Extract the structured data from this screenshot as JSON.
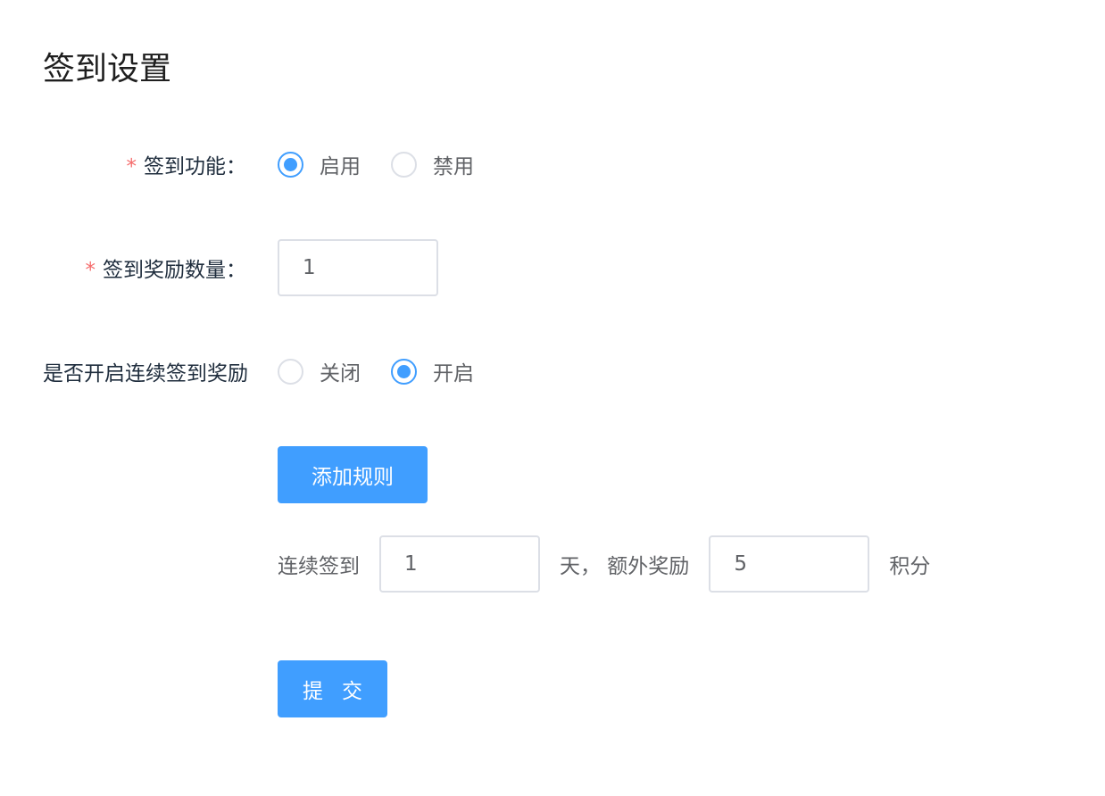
{
  "page": {
    "title": "签到设置"
  },
  "form": {
    "checkin_feature": {
      "label": "签到功能：",
      "required_mark": "*",
      "options": [
        {
          "label": "启用",
          "checked": true
        },
        {
          "label": "禁用",
          "checked": false
        }
      ]
    },
    "reward_amount": {
      "label": "签到奖励数量：",
      "required_mark": "*",
      "value": "1"
    },
    "continuous_reward": {
      "label": "是否开启连续签到奖励",
      "options": [
        {
          "label": "关闭",
          "checked": false
        },
        {
          "label": "开启",
          "checked": true
        }
      ]
    },
    "add_rule_button": "添加规则",
    "rule": {
      "prefix": "连续签到",
      "days_value": "1",
      "middle": "天， 额外奖励",
      "points_value": "5",
      "suffix": "积分"
    },
    "submit_button": "提 交"
  },
  "colors": {
    "accent": "#409eff",
    "required": "#f56c6c",
    "border": "#dcdfe6",
    "text_secondary": "#606266"
  }
}
